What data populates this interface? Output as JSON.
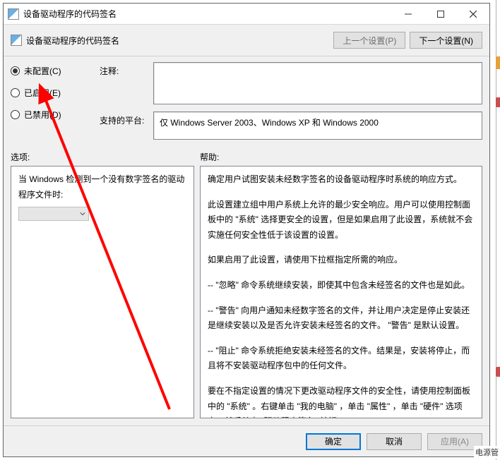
{
  "window": {
    "title": "设备驱动程序的代码签名",
    "min": "—",
    "max": "☐",
    "close": "✕"
  },
  "header": {
    "title": "设备驱动程序的代码签名",
    "prev": "上一个设置(P)",
    "next": "下一个设置(N)"
  },
  "radios": {
    "not_configured": "未配置(C)",
    "enabled": "已启用(E)",
    "disabled": "已禁用(D)",
    "selected": "not_configured"
  },
  "labels": {
    "comment": "注释:",
    "platform": "支持的平台:",
    "options": "选项:",
    "help": "帮助:"
  },
  "platform_text": "仅 Windows Server 2003、Windows XP 和 Windows 2000",
  "options_panel": {
    "line1": "当 Windows 检测到一个没有数字签名的驱动程序文件时:"
  },
  "help_panel": {
    "p1": "确定用户试图安装未经数字签名的设备驱动程序时系统的响应方式。",
    "p2": "此设置建立组中用户系统上允许的最少安全响应。用户可以使用控制面板中的 \"系统\" 选择更安全的设置，但是如果启用了此设置，系统就不会实施任何安全性低于该设置的设置。",
    "p3": "如果启用了此设置，请使用下拉框指定所需的响应。",
    "p4": "--  \"忽略\" 命令系统继续安装，即使其中包含未经签名的文件也是如此。",
    "p5": "--  \"警告\" 向用户通知未经数字签名的文件，并让用户决定是停止安装还是继续安装以及是否允许安装未经签名的文件。 \"警告\" 是默认设置。",
    "p6": "--  \"阻止\" 命令系统拒绝安装未经签名的文件。结果是，安装将停止，而且将不安装驱动程序包中的任何文件。",
    "p7": "要在不指定设置的情况下更改驱动程序文件的安全性，请使用控制面板中的 \"系统\" 。右键单击 \"我的电脑\" ，单击 \"属性\" ，单击 \"硬件\" 选项卡，然后单击 \"驱动程序签名\" 按钮。"
  },
  "footer": {
    "ok": "确定",
    "cancel": "取消",
    "apply": "应用(A)"
  },
  "annotation": {
    "arrow_color": "#ff0000"
  },
  "peek_items": [
    "#e8a13a",
    "#c94f4f",
    "#c94f4f"
  ],
  "peek_label": "电源管"
}
